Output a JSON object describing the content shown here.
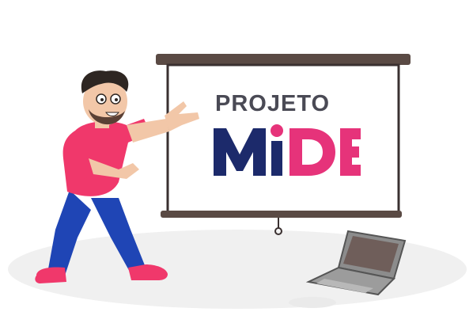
{
  "logo": {
    "line1": "PROJETO",
    "line2": "MIDE",
    "colors": {
      "line1": "#4a4a55",
      "m": "#1c2a6b",
      "i_dot": "#e6337a",
      "de": "#e6337a"
    }
  },
  "illustration": {
    "description_icons": [
      "projector-screen-icon",
      "presenter-person-icon",
      "laptop-icon"
    ],
    "colors": {
      "shirt": "#f0386b",
      "pants": "#1f45b5",
      "shoes": "#f0386b",
      "skin": "#f2c7a8",
      "hair": "#2e2622",
      "screen_frame": "#5a4a44",
      "laptop": "#8c8c8c",
      "shadow": "#eeeeee"
    }
  }
}
